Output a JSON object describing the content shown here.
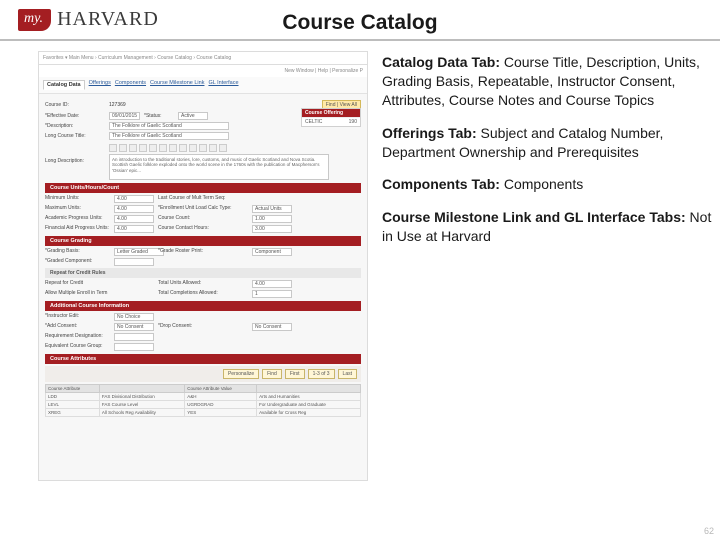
{
  "logo": {
    "badge": "my.",
    "word": "HARVARD"
  },
  "title": "Course Catalog",
  "slide_number": "62",
  "descriptions": {
    "catalog_label": "Catalog Data Tab: ",
    "catalog_body": "Course Title, Description, Units, Grading Basis, Repeatable, Instructor Consent, Attributes, Course Notes and Course Topics",
    "offerings_label": "Offerings Tab: ",
    "offerings_body": "Subject and Catalog Number, Department Ownership and Prerequisites",
    "components_label": "Components Tab: ",
    "components_body": "Components",
    "milestone_label": "Course Milestone Link and GL Interface Tabs: ",
    "milestone_body": "Not in Use at Harvard"
  },
  "screenshot": {
    "breadcrumb_left": "Favorites ▾  Main Menu  ›  Curriculum Management  ›  Course Catalog  ›  Course Catalog",
    "breadcrumb_right": "New Window | Help | Personalize P",
    "tabs": [
      "Catalog Data",
      "Offerings",
      "Components",
      "Course Milestone Link",
      "GL Interface"
    ],
    "active_tab": "Catalog Data",
    "course_id_label": "Course ID:",
    "course_id_value": "127369",
    "find_btn": "Find | View All",
    "eff_date_label": "*Effective Date:",
    "eff_date_value": "09/01/2015",
    "status_label": "*Status:",
    "status_value": "Active",
    "desc_label": "*Description:",
    "desc_value": "The Folklore of Gaelic Scotland",
    "long_title_label": "Long Course Title:",
    "long_title_value": "The Folklore of Gaelic Scotland",
    "long_desc_label": "Long Description:",
    "long_desc_text": "An introduction to the traditional stories, lore, customs, and music of Gaelic Scotland and Nova Scotia. Scottish Gaelic folklore exploded onto the world scene in the 1760s with the publication of Macpherson's 'Ossian' epic...",
    "offer_box": {
      "header": "Course Offering",
      "row1l": "CELTIC",
      "row1r": "190"
    },
    "section_units": "Course Units/Hours/Count",
    "units": {
      "min_l": "Minimum Units:",
      "min_v": "4.00",
      "max_l": "Maximum Units:",
      "max_v": "4.00",
      "acad_l": "Academic Progress Units:",
      "acad_v": "4.00",
      "fin_l": "Financial Aid Progress Units:",
      "fin_v": "4.00",
      "last_l": "Last Course of Mult Term Seq:",
      "enrl_l": "*Enrollment Unit Load Calc Type:",
      "enrl_v": "Actual Units",
      "cc_l": "Course Count:",
      "cc_v": "1.00",
      "cch_l": "Course Contact Hours:",
      "cch_v": "3.00"
    },
    "section_grading": "Course Grading",
    "grading": {
      "basis_l": "*Grading Basis:",
      "basis_v": "Letter Graded",
      "roster_l": "*Grade Roster Print:",
      "roster_v": "Component",
      "comp_l": "*Graded Component:"
    },
    "section_repeat": "Repeat for Credit Rules",
    "repeat": {
      "rfc_l": "Repeat for Credit",
      "mult_l": "Allow Multiple Enroll in Term",
      "tua_l": "Total Units Allowed:",
      "tua_v": "4.00",
      "tca_l": "Total Completions Allowed:",
      "tca_v": "1"
    },
    "section_addl": "Additional Course Information",
    "addl": {
      "instr_l": "*Instructor Edit:",
      "instr_v": "No Choice",
      "add_l": "*Add Consent:",
      "add_v": "No Consent",
      "drop_l": "*Drop Consent:",
      "drop_v": "No Consent",
      "req_l": "Requirement Designation:",
      "eq_l": "Equivalent Course Group:"
    },
    "section_attrs": "Course Attributes",
    "attrs": {
      "headers": [
        "Course Attribute",
        "",
        "Course Attribute Value",
        ""
      ],
      "rows": [
        [
          "LDD",
          "FAS Divisional Distribution",
          "A&H",
          "Arts and Humanities"
        ],
        [
          "LEVL",
          "FAS Course Level",
          "UGRDGRAD",
          "For Undergraduate and Graduate"
        ],
        [
          "XREG",
          "All Schools Reg Availability",
          "YES",
          "Available for Cross Reg"
        ]
      ]
    },
    "bottom_buttons": [
      "Personalize",
      "Find",
      "First",
      "1-3 of 3",
      "Last"
    ]
  }
}
